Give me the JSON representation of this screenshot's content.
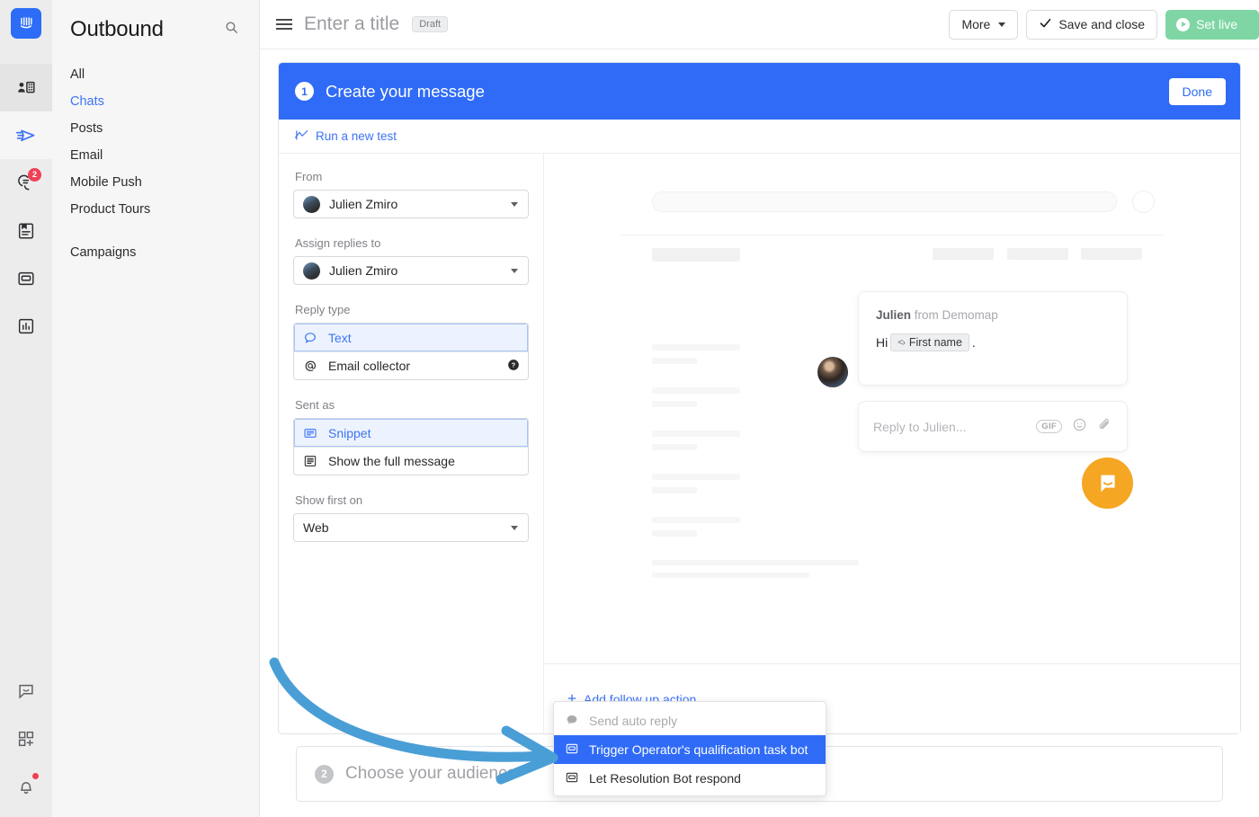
{
  "rail": {
    "logo_icon": "intercom-logo-icon",
    "items": [
      {
        "icon": "contacts-icon",
        "name": "contacts",
        "badge": ""
      },
      {
        "icon": "paper-plane-outbound-icon",
        "name": "outbound",
        "badge": ""
      },
      {
        "icon": "inbox-conversations-icon",
        "name": "inbox",
        "badge": "2"
      },
      {
        "icon": "articles-icon",
        "name": "articles",
        "badge": ""
      },
      {
        "icon": "messenger-icon",
        "name": "messenger",
        "badge": ""
      },
      {
        "icon": "reports-icon",
        "name": "reports",
        "badge": ""
      }
    ],
    "bottom_items": [
      {
        "icon": "chat-bubble-icon",
        "name": "messenger-preview",
        "badge": ""
      },
      {
        "icon": "apps-grid-plus-icon",
        "name": "app-store",
        "badge": ""
      },
      {
        "icon": "bell-icon",
        "name": "notifications",
        "badge": "dot"
      }
    ]
  },
  "sidebar": {
    "title": "Outbound",
    "search_icon": "search-icon",
    "items": [
      {
        "label": "All",
        "active": false
      },
      {
        "label": "Chats",
        "active": true
      },
      {
        "label": "Posts",
        "active": false
      },
      {
        "label": "Email",
        "active": false
      },
      {
        "label": "Mobile Push",
        "active": false
      },
      {
        "label": "Product Tours",
        "active": false
      }
    ],
    "items2": [
      {
        "label": "Campaigns",
        "active": false
      }
    ]
  },
  "topbar": {
    "menu_icon": "hamburger-menu-icon",
    "title_placeholder": "Enter a title",
    "status_badge": "Draft",
    "more_label": "More",
    "save_label": "Save and close",
    "set_live_label": "Set live",
    "check_icon": "check-icon",
    "play_icon": "play-icon"
  },
  "step1": {
    "number": "1",
    "title": "Create your message",
    "done_label": "Done",
    "test_link": "Run a new test",
    "test_icon": "chart-line-icon",
    "header_color": "#2f6bf6"
  },
  "form": {
    "from": {
      "label": "From",
      "value": "Julien Zmiro"
    },
    "assign": {
      "label": "Assign replies to",
      "value": "Julien Zmiro"
    },
    "reply_type": {
      "label": "Reply type",
      "options": [
        {
          "label": "Text",
          "icon": "speech-bubble-icon",
          "selected": true,
          "help": false
        },
        {
          "label": "Email collector",
          "icon": "at-sign-icon",
          "selected": false,
          "help": true
        }
      ]
    },
    "sent_as": {
      "label": "Sent as",
      "options": [
        {
          "label": "Snippet",
          "icon": "snippet-icon",
          "selected": true,
          "help": false
        },
        {
          "label": "Show the full message",
          "icon": "full-message-icon",
          "selected": false,
          "help": false
        }
      ]
    },
    "show_first_on": {
      "label": "Show first on",
      "value": "Web"
    }
  },
  "preview": {
    "message": {
      "sender_name": "Julien",
      "sender_suffix": "from Demomap",
      "greeting": "Hi",
      "token_label": "First name",
      "token_icon": "code-brackets-icon",
      "trailing": "."
    },
    "reply_placeholder": "Reply to Julien...",
    "reply_icons": [
      {
        "name": "gif-icon",
        "label": "GIF"
      },
      {
        "name": "emoji-icon",
        "label": ""
      },
      {
        "name": "attachment-paperclip-icon",
        "label": ""
      }
    ],
    "launcher_icon": "intercom-launcher-icon",
    "avatar_name": "julien-avatar"
  },
  "followup": {
    "link_label": "Add follow up action",
    "plus_icon": "plus-icon"
  },
  "dropdown": {
    "items": [
      {
        "label": "Send auto reply",
        "icon": "speech-bubble-filled-icon",
        "state": "disabled"
      },
      {
        "label": "Trigger Operator's qualification task bot",
        "icon": "task-bot-icon",
        "state": "highlight"
      },
      {
        "label": "Let Resolution Bot respond",
        "icon": "task-bot-icon",
        "state": "normal"
      }
    ],
    "highlight_color": "#2f6bf6"
  },
  "step2": {
    "number": "2",
    "title": "Choose your audience"
  },
  "annotation": {
    "arrow_name": "blue-annotation-arrow",
    "arrow_color": "#4a9ed6"
  }
}
